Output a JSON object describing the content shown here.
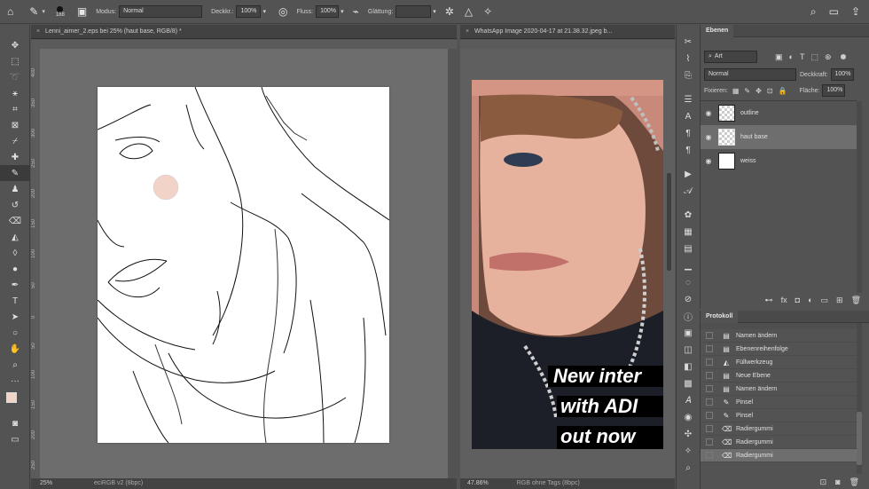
{
  "options_bar": {
    "brush_size": "188",
    "mode_label": "Modus:",
    "mode_value": "Normal",
    "opacity_label": "Deckkr.:",
    "opacity_value": "100%",
    "flow_label": "Fluss:",
    "flow_value": "100%",
    "smoothing_label": "Glättung:"
  },
  "docs": {
    "left": {
      "tab": "Lenni_aimer_2.eps bei 25% (haut base, RGB/8) *",
      "zoom": "25%",
      "profile": "eciRGB v2 (8bpc)"
    },
    "right": {
      "tab": "WhatsApp Image 2020-04-17 at 21.38.32.jpeg b...",
      "zoom": "47.86%",
      "profile": "RGB ohne Tags (8bpc)"
    },
    "ruler_left": [
      "400",
      "350",
      "300",
      "250",
      "200",
      "150",
      "100",
      "50",
      "0",
      "50",
      "100",
      "150",
      "200",
      "250"
    ],
    "overlay_lines": [
      "New inter",
      "with ADI",
      "out now"
    ]
  },
  "layers_panel": {
    "tab": "Ebenen",
    "filter_value": "Art",
    "blend_value": "Normal",
    "opacity_label": "Deckkraft:",
    "opacity_value": "100%",
    "lock_label": "Fixieren:",
    "fill_label": "Fläche:",
    "fill_value": "100%",
    "layers": [
      "outline",
      "haut base",
      "weiss"
    ]
  },
  "history_panel": {
    "tab": "Protokoll",
    "items": [
      "Namen ändern",
      "Ebenenreihenfolge",
      "Füllwerkzeug",
      "Neue Ebene",
      "Namen ändern",
      "Pinsel",
      "Pinsel",
      "Radiergummi",
      "Radiergummi",
      "Radiergummi"
    ]
  },
  "colors": {
    "ui_bg": "#535353",
    "canvas_bg": "#6d6d6d",
    "selected_layer": "#6e6e6e",
    "foreground": "#f2d3c8"
  }
}
